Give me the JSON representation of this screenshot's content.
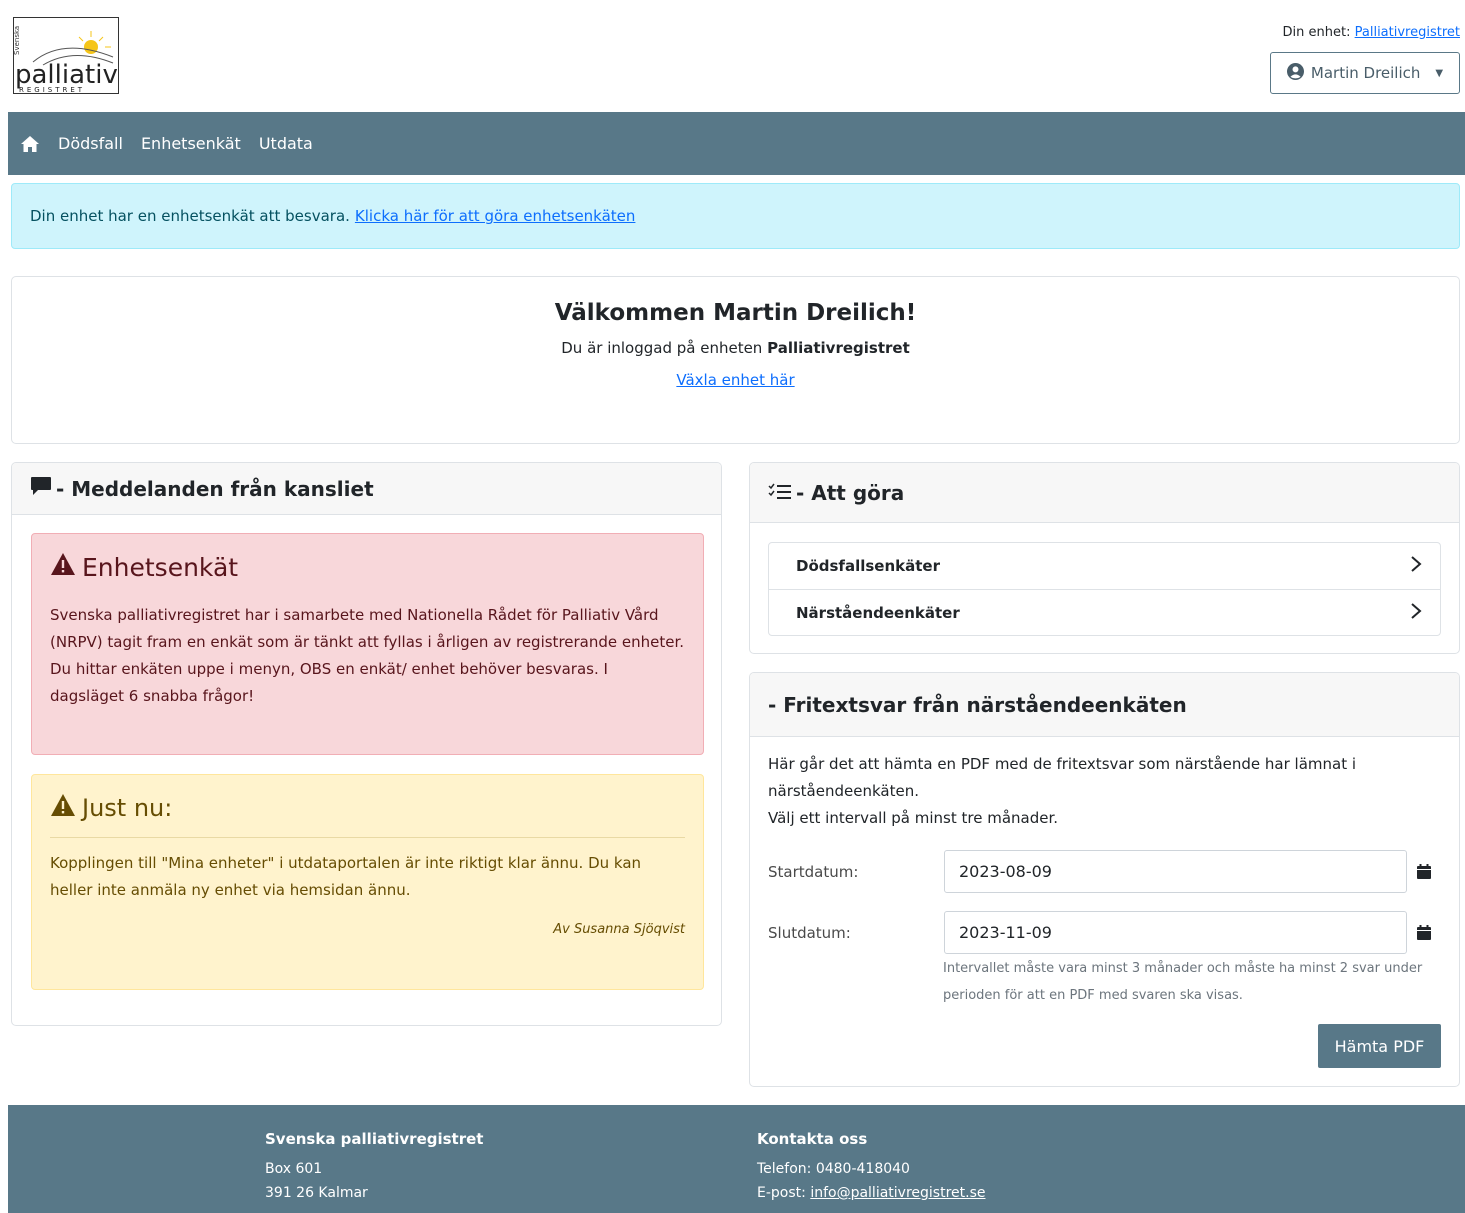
{
  "header": {
    "logo": {
      "top_text": "Svenska",
      "main": "palliativ",
      "sub": "REGISTRET"
    },
    "unit_label": "Din enhet:",
    "unit_link": "Palliativregistret",
    "user_name": "Martin Dreilich"
  },
  "nav": {
    "items": [
      "Dödsfall",
      "Enhetsenkät",
      "Utdata"
    ]
  },
  "alert": {
    "text": "Din enhet har en enhetsenkät att besvara.",
    "link": "Klicka här för att göra enhetsenkäten"
  },
  "welcome": {
    "title": "Välkommen Martin Dreilich!",
    "sub_prefix": "Du är inloggad på enheten",
    "unit": "Palliativregistret",
    "switch_link": "Växla enhet här"
  },
  "messages": {
    "title": "- Meddelanden från kansliet",
    "danger": {
      "title": "Enhetsenkät",
      "body": "Svenska palliativregistret har i samarbete med Nationella Rådet för Palliativ Vård (NRPV) tagit fram en enkät som är tänkt att fyllas i årligen av registrerande enheter. Du hittar enkäten uppe i menyn, OBS en enkät/ enhet behöver besvaras. I dagsläget 6 snabba frågor!"
    },
    "warning": {
      "title": "Just nu:",
      "body": "Kopplingen till \"Mina enheter\" i utdataportalen är inte riktigt klar ännu. Du kan heller inte anmäla ny enhet via hemsidan ännu.",
      "author": "Av Susanna Sjöqvist"
    }
  },
  "todo": {
    "title": "- Att göra",
    "items": [
      "Dödsfallsenkäter",
      "Närståendeenkäter"
    ]
  },
  "fritext": {
    "title": "- Fritextsvar från närståendeenkäten",
    "desc1": "Här går det att hämta en PDF med de fritextsvar som närstående har lämnat i närståendeenkäten.",
    "desc2": "Välj ett intervall på minst tre månader.",
    "start_label": "Startdatum:",
    "start_value": "2023-08-09",
    "end_label": "Slutdatum:",
    "end_value": "2023-11-09",
    "help": "Intervallet måste vara minst 3 månader och måste ha minst 2 svar under perioden för att en PDF med svaren ska visas.",
    "button": "Hämta PDF"
  },
  "footer": {
    "org": {
      "title": "Svenska palliativregistret",
      "line1": "Box 601",
      "line2": "391 26 Kalmar"
    },
    "contact": {
      "title": "Kontakta oss",
      "phone_label": "Telefon:",
      "phone": "0480-418040",
      "email_label": "E-post:",
      "email": "info@palliativregistret.se"
    }
  },
  "colors": {
    "primary": "#587888",
    "info_bg": "#cff4fc",
    "danger_bg": "#f8d7da",
    "warning_bg": "#fff3cd"
  },
  "icons": [
    "home-icon",
    "user-circle-icon",
    "comment-icon",
    "list-check-icon",
    "warning-triangle-icon",
    "chevron-right-icon",
    "calendar-icon"
  ]
}
